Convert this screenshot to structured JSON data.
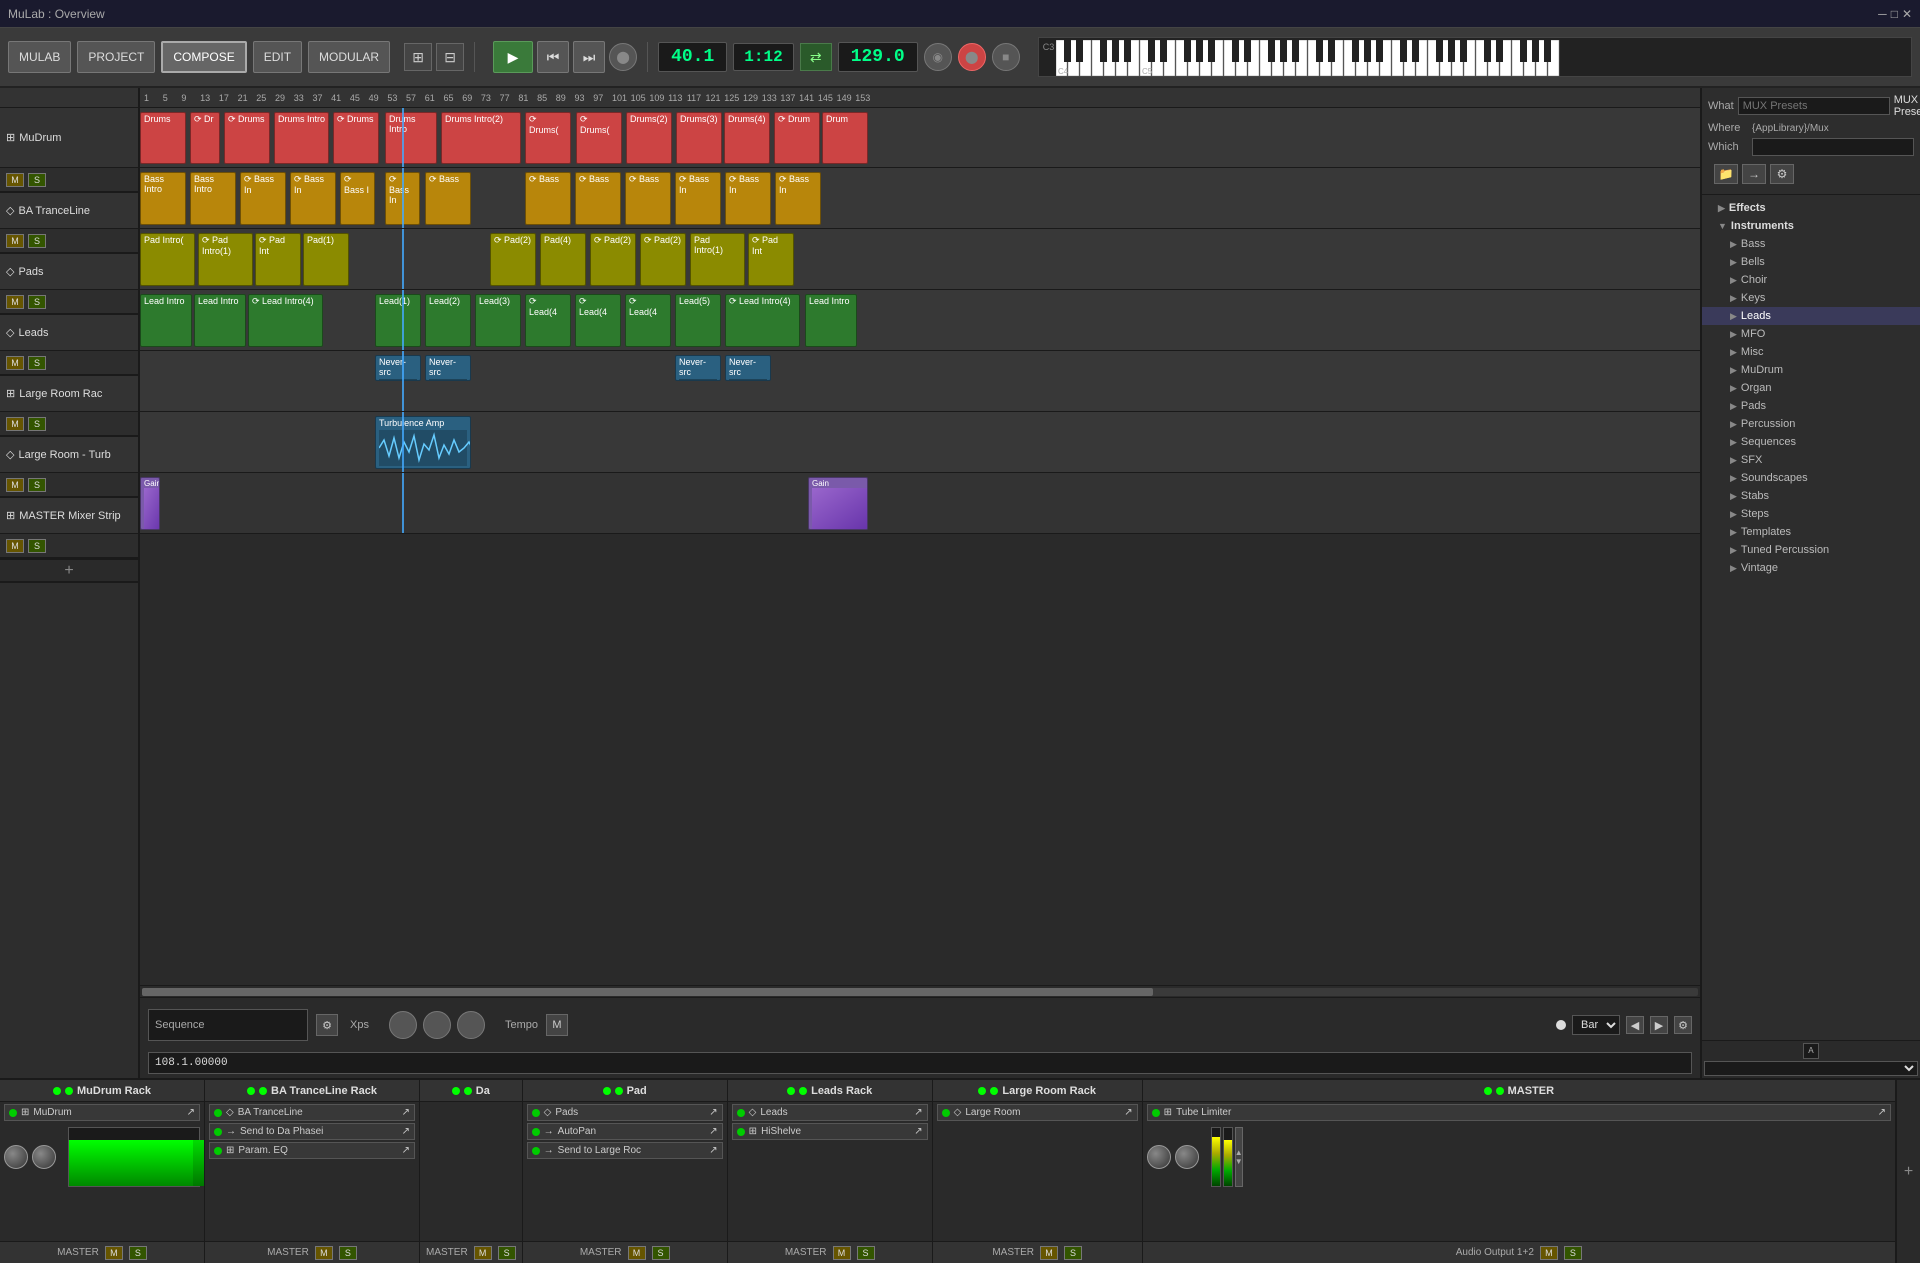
{
  "window": {
    "title": "MuLab : Overview"
  },
  "toolbar": {
    "mulab_label": "MULAB",
    "project_label": "PROJECT",
    "compose_label": "COMPOSE",
    "edit_label": "EDIT",
    "modular_label": "MODULAR",
    "position": "40.1",
    "time": "1:12",
    "bpm": "129.0"
  },
  "tracks": [
    {
      "name": "MuDrum",
      "type": "drums",
      "color": "#c44"
    },
    {
      "name": "BA TranceLine",
      "type": "bass",
      "color": "#b8860b"
    },
    {
      "name": "Pads",
      "type": "pads",
      "color": "#8b8b00"
    },
    {
      "name": "Leads",
      "type": "leads",
      "color": "#2d7a2d"
    },
    {
      "name": "Large Room Rac",
      "type": "audio",
      "color": "#2a6080"
    },
    {
      "name": "Large Room - Turb",
      "type": "audio2",
      "color": "#2a6080"
    },
    {
      "name": "MASTER Mixer Strip",
      "type": "master",
      "color": "#7a5aaa"
    }
  ],
  "right_panel": {
    "what_label": "What",
    "what_value": "MUX Presets",
    "where_label": "Where",
    "where_value": "{AppLibrary}/Mux",
    "which_label": "Which",
    "which_value": "",
    "tree": [
      {
        "label": "Effects",
        "type": "folder",
        "expanded": false
      },
      {
        "label": "Instruments",
        "type": "folder",
        "expanded": true
      },
      {
        "label": "Bass",
        "type": "sub"
      },
      {
        "label": "Bells",
        "type": "sub"
      },
      {
        "label": "Choir",
        "type": "sub"
      },
      {
        "label": "Keys",
        "type": "sub"
      },
      {
        "label": "Leads",
        "type": "sub",
        "selected": true
      },
      {
        "label": "MFO",
        "type": "sub"
      },
      {
        "label": "Misc",
        "type": "sub"
      },
      {
        "label": "MuDrum",
        "type": "sub"
      },
      {
        "label": "Organ",
        "type": "sub"
      },
      {
        "label": "Pads",
        "type": "sub"
      },
      {
        "label": "Percussion",
        "type": "sub"
      },
      {
        "label": "Sequences",
        "type": "sub"
      },
      {
        "label": "SFX",
        "type": "sub"
      },
      {
        "label": "Soundscapes",
        "type": "sub"
      },
      {
        "label": "Stabs",
        "type": "sub"
      },
      {
        "label": "Steps",
        "type": "sub"
      },
      {
        "label": "Templates",
        "type": "sub"
      },
      {
        "label": "Tuned Percussion",
        "type": "sub"
      },
      {
        "label": "Vintage",
        "type": "sub"
      }
    ]
  },
  "mixer": {
    "channels": [
      {
        "name": "MuDrum Rack",
        "plugins": [
          "MuDrum",
          ""
        ],
        "footer": "MASTER"
      },
      {
        "name": "BA TranceLine Rack",
        "plugins": [
          "BA TranceLine",
          "Send to Da Phasei",
          "Param. EQ"
        ],
        "footer": "MASTER"
      },
      {
        "name": "Da",
        "plugins": [],
        "footer": "MASTER"
      },
      {
        "name": "Pad",
        "plugins": [
          "Pads",
          "AutoPan",
          "Send to Large Roc"
        ],
        "footer": "MASTER"
      },
      {
        "name": "Leads Rack",
        "plugins": [
          "Leads",
          "HiShelve"
        ],
        "footer": "MASTER"
      },
      {
        "name": "Large Room Rack",
        "plugins": [
          "Large Room"
        ],
        "footer": "MASTER"
      },
      {
        "name": "MASTER",
        "plugins": [
          "Tube Limiter"
        ],
        "footer": "Audio Output 1+2"
      }
    ]
  },
  "bottom_seq": {
    "sequence_label": "Sequence",
    "xps_label": "Xps",
    "tempo_label": "Tempo",
    "bar_label": "Bar",
    "bar_value": "Bar",
    "tempo_value": "108.1.00000"
  },
  "ruler_marks": [
    "1",
    "5",
    "9",
    "13",
    "17",
    "21",
    "25",
    "29",
    "33",
    "37",
    "41",
    "45",
    "49",
    "53",
    "57",
    "61",
    "65",
    "69",
    "73",
    "77",
    "81",
    "85",
    "89",
    "93",
    "97",
    "101",
    "105",
    "109",
    "113",
    "117",
    "121",
    "125",
    "129",
    "133",
    "137",
    "141",
    "145",
    "149",
    "153"
  ]
}
